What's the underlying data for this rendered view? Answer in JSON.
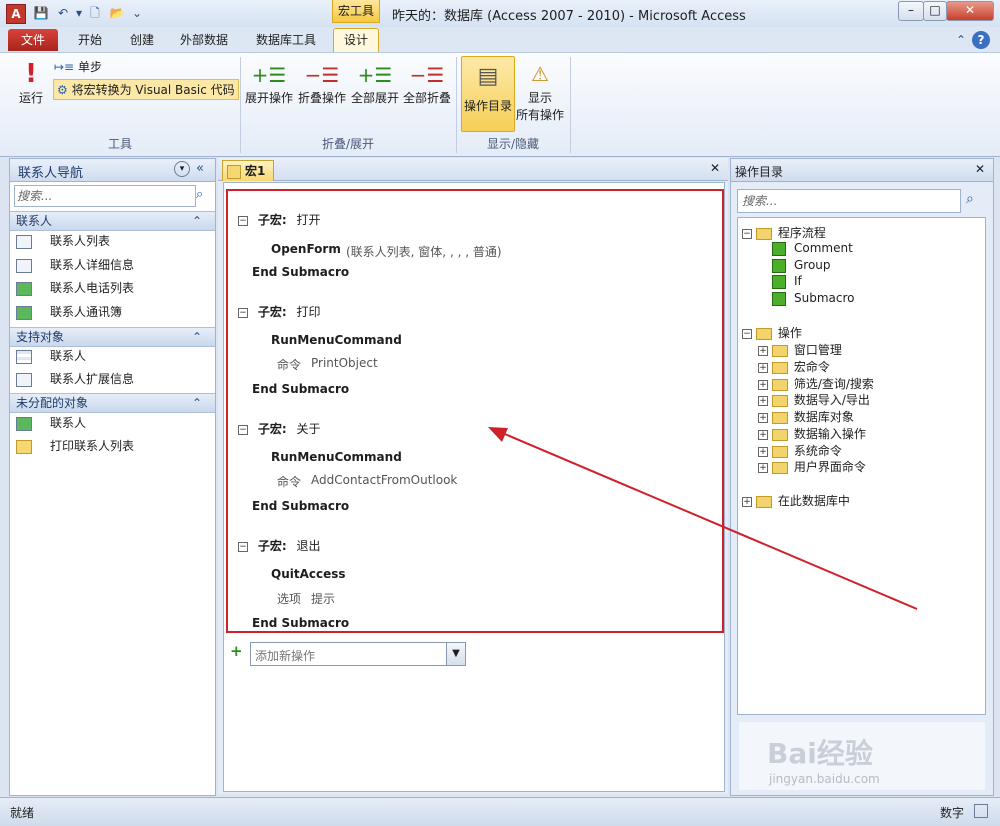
{
  "titlebar": {
    "window_title": "昨天的：数据库 (Access 2007 - 2010) - Microsoft Access",
    "context_tab_header": "宏工具",
    "app_icon_letter": "A"
  },
  "ribbon_tabs": [
    "文件",
    "开始",
    "创建",
    "外部数据",
    "数据库工具",
    "设计"
  ],
  "ribbon": {
    "tools_group": {
      "run": "运行",
      "single_step": "单步",
      "convert": "将宏转换为 Visual Basic 代码",
      "label": "工具"
    },
    "collapse_group": {
      "expand_actions": "展开操作",
      "collapse_actions": "折叠操作",
      "expand_all": "全部展开",
      "collapse_all": "全部折叠",
      "label": "折叠/展开"
    },
    "show_hide_group": {
      "action_catalog": "操作目录",
      "show_all_line1": "显示",
      "show_all_line2": "所有操作",
      "label": "显示/隐藏"
    }
  },
  "nav_pane": {
    "title": "联系人导航",
    "search_placeholder": "搜索...",
    "sections": [
      {
        "title": "联系人",
        "items": [
          "联系人列表",
          "联系人详细信息",
          "联系人电话列表",
          "联系人通讯簿"
        ]
      },
      {
        "title": "支持对象",
        "items": [
          "联系人",
          "联系人扩展信息"
        ]
      },
      {
        "title": "未分配的对象",
        "items": [
          "联系人",
          "打印联系人列表"
        ]
      }
    ]
  },
  "document": {
    "tab_label": "宏1",
    "submacros": [
      {
        "label": "子宏:",
        "name": "打开",
        "action": "OpenForm",
        "args": "(联系人列表, 窗体, , , , 普通)",
        "end": "End Submacro"
      },
      {
        "label": "子宏:",
        "name": "打印",
        "action": "RunMenuCommand",
        "arg_label": "命令",
        "arg_value": "PrintObject",
        "end": "End Submacro"
      },
      {
        "label": "子宏:",
        "name": "关于",
        "action": "RunMenuCommand",
        "arg_label": "命令",
        "arg_value": "AddContactFromOutlook",
        "end": "End Submacro"
      },
      {
        "label": "子宏:",
        "name": "退出",
        "action": "QuitAccess",
        "arg_label": "选项",
        "arg_value": "提示",
        "end": "End Submacro"
      }
    ],
    "add_action_placeholder": "添加新操作"
  },
  "catalog": {
    "title": "操作目录",
    "search_placeholder": "搜索...",
    "program_flow": {
      "label": "程序流程",
      "items": [
        "Comment",
        "Group",
        "If",
        "Submacro"
      ]
    },
    "actions": {
      "label": "操作",
      "items": [
        "窗口管理",
        "宏命令",
        "筛选/查询/搜索",
        "数据导入/导出",
        "数据库对象",
        "数据输入操作",
        "系统命令",
        "用户界面命令"
      ]
    },
    "in_database": "在此数据库中"
  },
  "watermark": {
    "brand": "Bai经验",
    "url": "jingyan.baidu.com"
  },
  "statusbar": {
    "left": "就绪",
    "right": "数字"
  },
  "colors": {
    "highlight": "#d0202a",
    "arrow": "#d0202a",
    "file_tab": "#c0392b"
  }
}
